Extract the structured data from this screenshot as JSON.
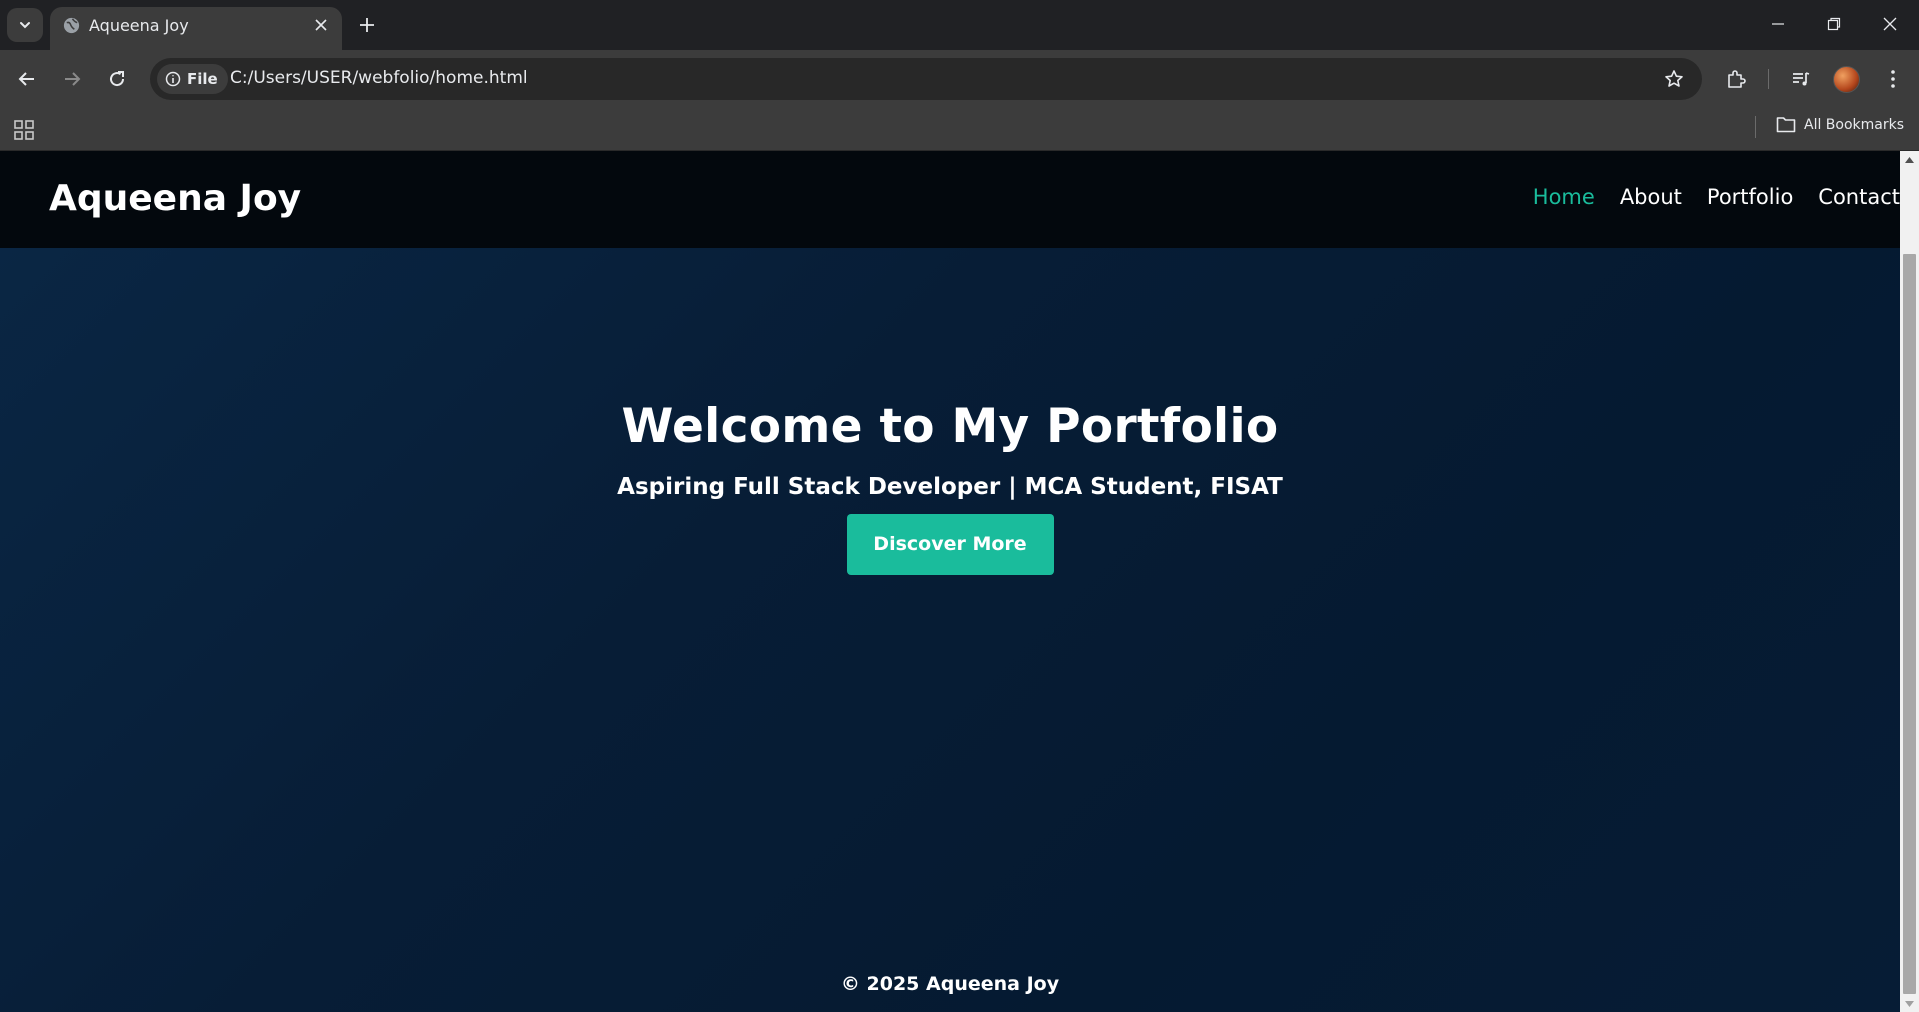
{
  "browser": {
    "tab": {
      "title": "Aqueena Joy"
    },
    "address": {
      "scheme_chip": "File",
      "url": "C:/Users/USER/webfolio/home.html"
    },
    "bookmarks": {
      "all_label": "All Bookmarks"
    }
  },
  "site": {
    "logo": "Aqueena Joy",
    "nav": [
      "Home",
      "About",
      "Portfolio",
      "Contact"
    ],
    "active_nav": "Home",
    "accent_color": "#1abc9c",
    "hero": {
      "title": "Welcome to My Portfolio",
      "subtitle": "Aspiring Full Stack Developer | MCA Student, FISAT",
      "button": "Discover More"
    },
    "footer": "© 2025 Aqueena Joy"
  },
  "icons": {
    "tab_search": "chevron-down-icon",
    "favicon": "globe-icon",
    "tab_close": "close-icon",
    "new_tab": "plus-icon",
    "back": "arrow-left-icon",
    "forward": "arrow-right-icon",
    "reload": "reload-icon",
    "site_info": "info-icon",
    "bookmark": "star-icon",
    "extensions": "puzzle-icon",
    "reading_list": "queue-music-icon",
    "menu": "kebab-menu-icon",
    "apps": "apps-grid-icon",
    "folder": "folder-icon"
  }
}
